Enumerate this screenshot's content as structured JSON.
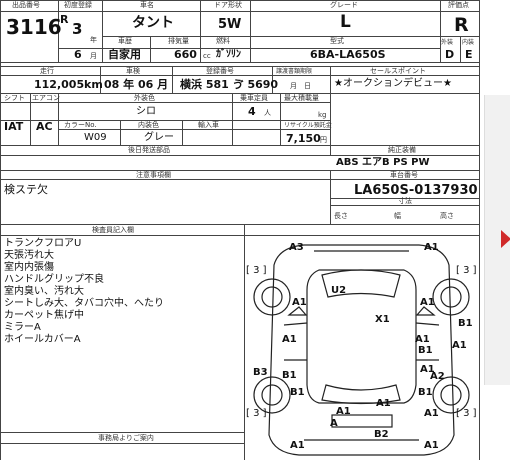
{
  "header": {
    "lot_label": "出品番号",
    "lot": "3116",
    "year_label": "初度登録",
    "era": "R",
    "year": "3",
    "year_unit": "年",
    "month": "6",
    "month_unit": "月",
    "car_name_label": "車名",
    "car_name": "タント",
    "doors_label": "ドア形状",
    "doors": "5W",
    "grade_label": "グレード",
    "grade": "L",
    "score_label": "評価点",
    "score": "R",
    "usage_label": "車歴",
    "usage": "自家用",
    "displacement_label": "排気量",
    "displacement": "660",
    "displacement_unit": "cc",
    "fuel_label": "燃料",
    "fuel": "ｶﾞｿﾘﾝ",
    "model_label": "型式",
    "model": "6BA-LA650S",
    "ext_label": "外装",
    "ext_grade": "D",
    "int_label": "内装",
    "int_grade": "E"
  },
  "row2": {
    "mileage_label": "走行",
    "mileage": "112,005",
    "mileage_unit": "km",
    "inspection_label": "車検",
    "inspection": "08 年 06 月",
    "plate_label": "登録番号",
    "plate": "横浜 581 ゔ 5690",
    "transfer_label": "譲渡書類期限",
    "transfer": "月　日",
    "sales_point_label": "セールスポイント",
    "sales_point": "★オークションデビュー★"
  },
  "row3": {
    "shift_label": "シフト",
    "shift": "IAT",
    "ac_label": "エアコン",
    "ac": "AC",
    "color_label": "外装色",
    "color": "シロ",
    "seats_label": "乗車定員",
    "seats": "4",
    "seats_unit": "人",
    "load_label": "最大積載量",
    "load_unit": "kg",
    "color_no_label": "カラーNo.",
    "color_no": "W09",
    "int_color_label": "内装色",
    "int_color": "グレー",
    "import_label": "輸入車",
    "import_val": "",
    "recycle_label": "リサイクル預託金",
    "recycle": "7,150",
    "recycle_unit": "円",
    "legal_label": "後日発送部品",
    "equipment_label": "純正装備",
    "equipment": "ABS エアB PS PW"
  },
  "notes": {
    "notes_label": "注意事項欄",
    "notes_text": "検ステ欠",
    "chassis_label": "車台番号",
    "chassis": "LA650S-0137930",
    "size_label": "寸法",
    "len": "長さ",
    "width": "幅",
    "height": "高さ",
    "inspector_label": "検査員記入欄",
    "inspector_lines": [
      "トランクフロアU",
      "天張汚れ大",
      "室内内張傷",
      "ハンドルグリップ不良",
      "室内臭い、汚れ大",
      "シートしみ大、タバコ穴中、へたり",
      "カーペット焦げ中",
      "ミラーA",
      "ホイールカバーA"
    ],
    "office_label": "事務局よりご案内"
  },
  "diagram": {
    "marks": [
      "A3",
      "A1",
      "U2",
      "A1",
      "A1",
      "A1",
      "X1",
      "A1",
      "B1",
      "A1",
      "B1",
      "B1",
      "B3",
      "B1",
      "A1",
      "A2",
      "B1",
      "A1",
      "A1",
      "A1",
      "A",
      "B2",
      "A1",
      "A1"
    ],
    "brackets": [
      "[ 3 ]",
      "[ 3 ]",
      "[ 3 ]",
      "[ 3 ]"
    ]
  },
  "nav": {
    "arrow": "next-arrow"
  },
  "colors": {
    "arrow": "#d02a2a",
    "line": "#444444"
  }
}
